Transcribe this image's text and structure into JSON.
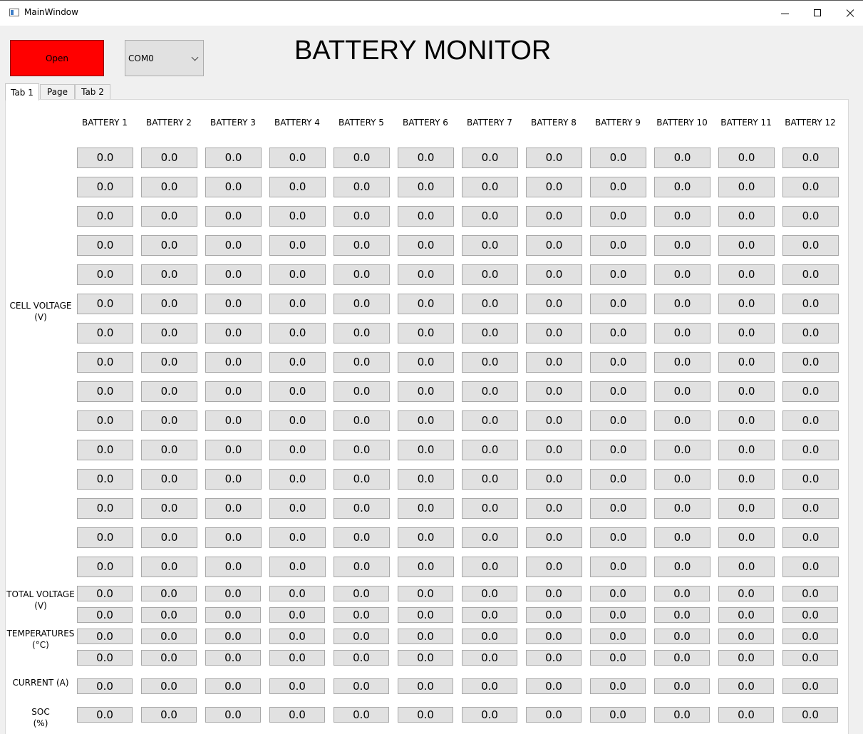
{
  "window": {
    "title": "MainWindow"
  },
  "toolbar": {
    "open_label": "Open",
    "com_port": "COM0"
  },
  "app_title": "BATTERY MONITOR",
  "tabs": [
    "Tab 1",
    "Page",
    "Tab 2"
  ],
  "battery_headers": [
    "BATTERY 1",
    "BATTERY 2",
    "BATTERY 3",
    "BATTERY 4",
    "BATTERY 5",
    "BATTERY 6",
    "BATTERY 7",
    "BATTERY 8",
    "BATTERY 9",
    "BATTERY 10",
    "BATTERY 11",
    "BATTERY 12"
  ],
  "row_labels": {
    "cell_voltage": [
      "CELL VOLTAGE",
      "(V)"
    ],
    "total_voltage": [
      "TOTAL VOLTAGE",
      "(V)"
    ],
    "temperatures": [
      "TEMPERATURES",
      "(°C)"
    ],
    "current": [
      "CURRENT (A)"
    ],
    "soc": [
      "SOC",
      "(%)"
    ]
  },
  "cell_voltage": [
    [
      "0.0",
      "0.0",
      "0.0",
      "0.0",
      "0.0",
      "0.0",
      "0.0",
      "0.0",
      "0.0",
      "0.0",
      "0.0",
      "0.0"
    ],
    [
      "0.0",
      "0.0",
      "0.0",
      "0.0",
      "0.0",
      "0.0",
      "0.0",
      "0.0",
      "0.0",
      "0.0",
      "0.0",
      "0.0"
    ],
    [
      "0.0",
      "0.0",
      "0.0",
      "0.0",
      "0.0",
      "0.0",
      "0.0",
      "0.0",
      "0.0",
      "0.0",
      "0.0",
      "0.0"
    ],
    [
      "0.0",
      "0.0",
      "0.0",
      "0.0",
      "0.0",
      "0.0",
      "0.0",
      "0.0",
      "0.0",
      "0.0",
      "0.0",
      "0.0"
    ],
    [
      "0.0",
      "0.0",
      "0.0",
      "0.0",
      "0.0",
      "0.0",
      "0.0",
      "0.0",
      "0.0",
      "0.0",
      "0.0",
      "0.0"
    ],
    [
      "0.0",
      "0.0",
      "0.0",
      "0.0",
      "0.0",
      "0.0",
      "0.0",
      "0.0",
      "0.0",
      "0.0",
      "0.0",
      "0.0"
    ],
    [
      "0.0",
      "0.0",
      "0.0",
      "0.0",
      "0.0",
      "0.0",
      "0.0",
      "0.0",
      "0.0",
      "0.0",
      "0.0",
      "0.0"
    ],
    [
      "0.0",
      "0.0",
      "0.0",
      "0.0",
      "0.0",
      "0.0",
      "0.0",
      "0.0",
      "0.0",
      "0.0",
      "0.0",
      "0.0"
    ],
    [
      "0.0",
      "0.0",
      "0.0",
      "0.0",
      "0.0",
      "0.0",
      "0.0",
      "0.0",
      "0.0",
      "0.0",
      "0.0",
      "0.0"
    ],
    [
      "0.0",
      "0.0",
      "0.0",
      "0.0",
      "0.0",
      "0.0",
      "0.0",
      "0.0",
      "0.0",
      "0.0",
      "0.0",
      "0.0"
    ],
    [
      "0.0",
      "0.0",
      "0.0",
      "0.0",
      "0.0",
      "0.0",
      "0.0",
      "0.0",
      "0.0",
      "0.0",
      "0.0",
      "0.0"
    ],
    [
      "0.0",
      "0.0",
      "0.0",
      "0.0",
      "0.0",
      "0.0",
      "0.0",
      "0.0",
      "0.0",
      "0.0",
      "0.0",
      "0.0"
    ],
    [
      "0.0",
      "0.0",
      "0.0",
      "0.0",
      "0.0",
      "0.0",
      "0.0",
      "0.0",
      "0.0",
      "0.0",
      "0.0",
      "0.0"
    ],
    [
      "0.0",
      "0.0",
      "0.0",
      "0.0",
      "0.0",
      "0.0",
      "0.0",
      "0.0",
      "0.0",
      "0.0",
      "0.0",
      "0.0"
    ],
    [
      "0.0",
      "0.0",
      "0.0",
      "0.0",
      "0.0",
      "0.0",
      "0.0",
      "0.0",
      "0.0",
      "0.0",
      "0.0",
      "0.0"
    ]
  ],
  "total_voltage": [
    [
      "0.0",
      "0.0",
      "0.0",
      "0.0",
      "0.0",
      "0.0",
      "0.0",
      "0.0",
      "0.0",
      "0.0",
      "0.0",
      "0.0"
    ],
    [
      "0.0",
      "0.0",
      "0.0",
      "0.0",
      "0.0",
      "0.0",
      "0.0",
      "0.0",
      "0.0",
      "0.0",
      "0.0",
      "0.0"
    ]
  ],
  "temperatures": [
    [
      "0.0",
      "0.0",
      "0.0",
      "0.0",
      "0.0",
      "0.0",
      "0.0",
      "0.0",
      "0.0",
      "0.0",
      "0.0",
      "0.0"
    ],
    [
      "0.0",
      "0.0",
      "0.0",
      "0.0",
      "0.0",
      "0.0",
      "0.0",
      "0.0",
      "0.0",
      "0.0",
      "0.0",
      "0.0"
    ]
  ],
  "current": [
    "0.0",
    "0.0",
    "0.0",
    "0.0",
    "0.0",
    "0.0",
    "0.0",
    "0.0",
    "0.0",
    "0.0",
    "0.0",
    "0.0"
  ],
  "soc": [
    "0.0",
    "0.0",
    "0.0",
    "0.0",
    "0.0",
    "0.0",
    "0.0",
    "0.0",
    "0.0",
    "0.0",
    "0.0",
    "0.0"
  ],
  "colors": {
    "open_button": "#ff0000",
    "field_bg": "#e1e1e1",
    "panel_bg": "#ffffff",
    "window_bg": "#f0f0f0"
  }
}
